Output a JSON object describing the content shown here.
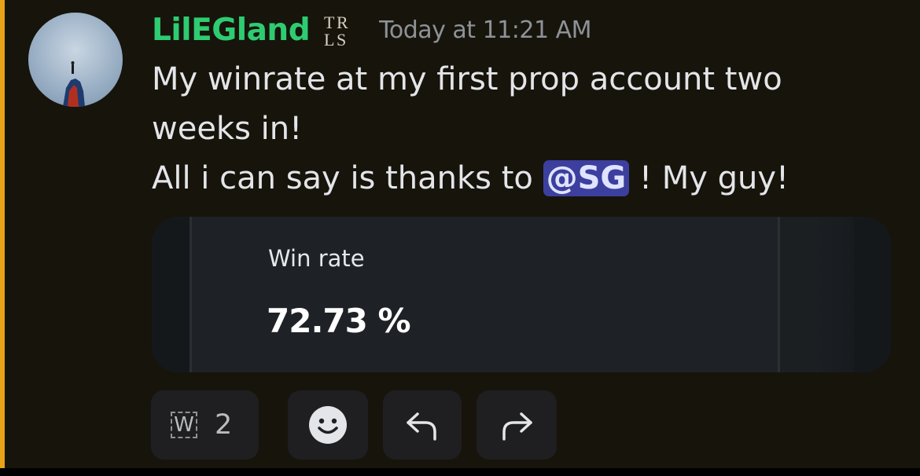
{
  "message": {
    "author": "LilEGland",
    "timestamp": "Today at 11:21 AM",
    "role_badge_icon": "trls-monogram-icon",
    "lines": [
      "My winrate at my first prop account two weeks in!"
    ],
    "line2_prefix": "All i can say is thanks to ",
    "mention": "@SG",
    "line2_suffix": " ! My guy!"
  },
  "embed": {
    "label": "Win rate",
    "value": "72.73 %"
  },
  "reactions": [
    {
      "emoji_text": "W",
      "count": "2"
    }
  ],
  "actions": {
    "add_reaction_icon": "smiley-icon",
    "reply_icon": "reply-arrow-icon",
    "forward_icon": "forward-arrow-icon"
  },
  "colors": {
    "highlight_bar": "#e8a317",
    "username": "#2ecc71",
    "mention_bg": "#3c3f9e",
    "background": "#17140c"
  }
}
